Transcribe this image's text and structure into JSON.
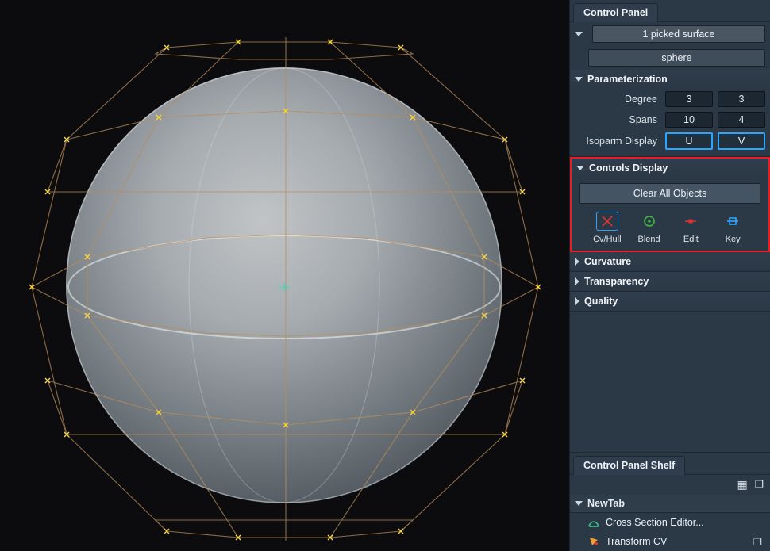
{
  "panel": {
    "title": "Control Panel",
    "picked_label": "1 picked surface",
    "object_name": "sphere",
    "sections": {
      "parameterization": {
        "title": "Parameterization",
        "degree_label": "Degree",
        "degree_u": "3",
        "degree_v": "3",
        "spans_label": "Spans",
        "spans_u": "10",
        "spans_v": "4",
        "isoparm_label": "Isoparm Display",
        "u_label": "U",
        "v_label": "V"
      },
      "controls_display": {
        "title": "Controls Display",
        "clear_label": "Clear All Objects",
        "buttons": {
          "cvhull": "Cv/Hull",
          "blend": "Blend",
          "edit": "Edit",
          "key": "Key"
        }
      },
      "curvature": {
        "title": "Curvature"
      },
      "transparency": {
        "title": "Transparency"
      },
      "quality": {
        "title": "Quality"
      }
    }
  },
  "shelf": {
    "title": "Control Panel Shelf",
    "newtab_title": "NewTab",
    "items": {
      "cross_section": "Cross Section Editor...",
      "transform_cv": "Transform CV"
    }
  }
}
